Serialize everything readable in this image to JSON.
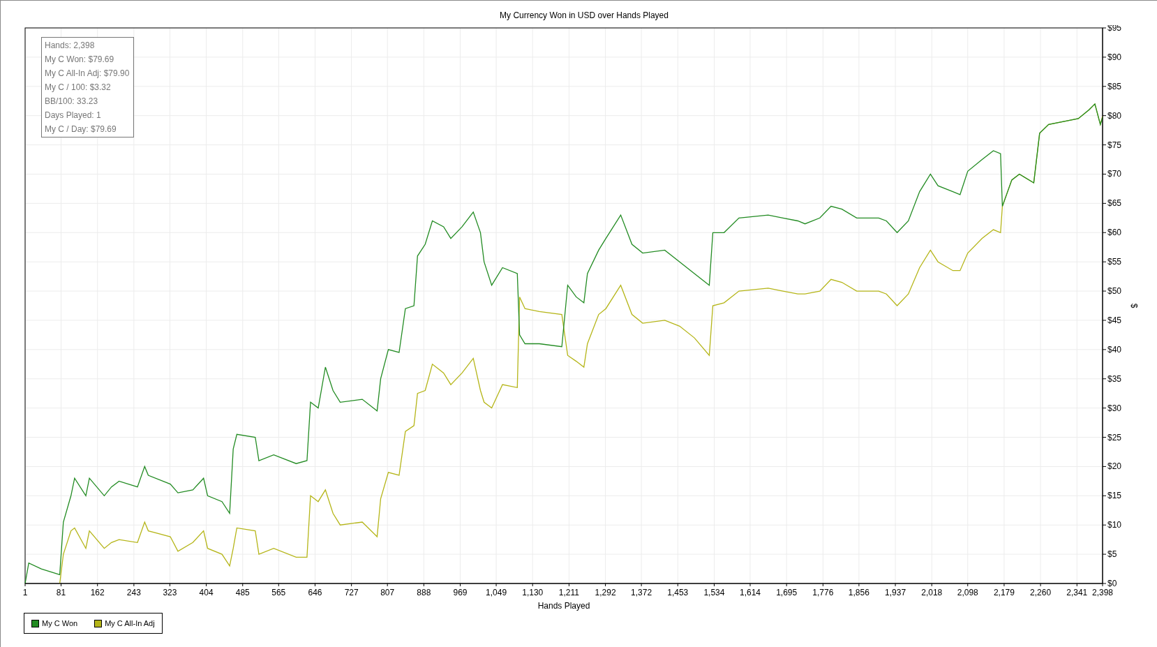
{
  "chart": {
    "chart_data": {
      "type": "line",
      "grid": true,
      "title": "My Currency Won in USD over Hands Played",
      "xlabel": "Hands Played",
      "ylabel": "$",
      "x": [
        1,
        9,
        37,
        78,
        86,
        103,
        111,
        136,
        144,
        177,
        193,
        210,
        251,
        267,
        275,
        324,
        341,
        374,
        398,
        407,
        439,
        456,
        464,
        472,
        513,
        521,
        554,
        604,
        628,
        636,
        653,
        669,
        686,
        702,
        751,
        784,
        792,
        809,
        833,
        847,
        866,
        874,
        891,
        907,
        932,
        948,
        973,
        998,
        1014,
        1022,
        1039,
        1063,
        1096,
        1101,
        1113,
        1145,
        1195,
        1208,
        1227,
        1244,
        1252,
        1277,
        1293,
        1326,
        1351,
        1375,
        1424,
        1457,
        1490,
        1523,
        1531,
        1556,
        1589,
        1654,
        1687,
        1720,
        1736,
        1769,
        1794,
        1818,
        1851,
        1900,
        1917,
        1941,
        1966,
        1991,
        2015,
        2032,
        2065,
        2081,
        2098,
        2130,
        2155,
        2171,
        2175,
        2196,
        2213,
        2245,
        2258,
        2278,
        2311,
        2344,
        2368,
        2381,
        2393,
        2398
      ],
      "series": [
        {
          "name": "My C Won",
          "color": "#228b22",
          "values": [
            0,
            3.5,
            2.5,
            1.5,
            10.5,
            15,
            18,
            15,
            18,
            15,
            16.5,
            17.5,
            16.5,
            20,
            18.5,
            17,
            15.5,
            16,
            18,
            15,
            14,
            12,
            23,
            25.5,
            25,
            21,
            22,
            20.5,
            21,
            31,
            30,
            37,
            33,
            31,
            31.5,
            29.5,
            35,
            40,
            39.5,
            47,
            47.5,
            56,
            58,
            62,
            61,
            59,
            61,
            63.5,
            60,
            55,
            51,
            54,
            53,
            42.5,
            41,
            41,
            40.5,
            51,
            49,
            48,
            53,
            57,
            59,
            63,
            58,
            56.5,
            57,
            55,
            53,
            51,
            60,
            60,
            62.5,
            63,
            62.5,
            62,
            61.5,
            62.5,
            64.5,
            64,
            62.5,
            62.5,
            62,
            60,
            62,
            67,
            70,
            68,
            67,
            66.5,
            70.5,
            72.5,
            74,
            73.5,
            64.5,
            69,
            70,
            68.5,
            77,
            78.5,
            79,
            79.5,
            81,
            82,
            78.5,
            79.7
          ]
        },
        {
          "name": "My C All-In Adj",
          "color": "#b5b518",
          "values": [
            null,
            null,
            null,
            0,
            5,
            9,
            9.5,
            6,
            9,
            6,
            7,
            7.5,
            7,
            10.5,
            9,
            8,
            5.5,
            7,
            9,
            6,
            5,
            3,
            6,
            9.5,
            9,
            5,
            6,
            4.5,
            4.5,
            15,
            14,
            16,
            12,
            10,
            10.5,
            8,
            14.5,
            19,
            18.5,
            26,
            27,
            32.5,
            33,
            37.5,
            36,
            34,
            36,
            38.5,
            33,
            31,
            30,
            34,
            33.5,
            49,
            47,
            46.5,
            46,
            39,
            38,
            37,
            41,
            46,
            47,
            51,
            46,
            44.5,
            45,
            44,
            42,
            39,
            47.5,
            48,
            50,
            50.5,
            50,
            49.5,
            49.5,
            50,
            52,
            51.5,
            50,
            50,
            49.5,
            47.5,
            49.5,
            54,
            57,
            55,
            53.5,
            53.5,
            56.5,
            59,
            60.5,
            60,
            64.5,
            69,
            70,
            68.5,
            77,
            78.5,
            79,
            79.5,
            81,
            82,
            78.5,
            79.9
          ]
        }
      ],
      "xlim": [
        1,
        2398
      ],
      "ylim": [
        0,
        95
      ],
      "xticks": [
        1,
        81,
        162,
        243,
        323,
        404,
        485,
        565,
        646,
        727,
        807,
        888,
        969,
        {
          "value": 1049,
          "label": "1,049"
        },
        {
          "value": 1130,
          "label": "1,130"
        },
        {
          "value": 1211,
          "label": "1,211"
        },
        {
          "value": 1292,
          "label": "1,292"
        },
        {
          "value": 1372,
          "label": "1,372"
        },
        {
          "value": 1453,
          "label": "1,453"
        },
        {
          "value": 1534,
          "label": "1,534"
        },
        {
          "value": 1614,
          "label": "1,614"
        },
        {
          "value": 1695,
          "label": "1,695"
        },
        {
          "value": 1776,
          "label": "1,776"
        },
        {
          "value": 1856,
          "label": "1,856"
        },
        {
          "value": 1937,
          "label": "1,937"
        },
        {
          "value": 2018,
          "label": "2,018"
        },
        {
          "value": 2098,
          "label": "2,098"
        },
        {
          "value": 2179,
          "label": "2,179"
        },
        {
          "value": 2260,
          "label": "2,260"
        },
        {
          "value": 2341,
          "label": "2,341"
        },
        {
          "value": 2398,
          "label": "2,398"
        }
      ],
      "yticks": [
        {
          "value": 0,
          "label": "$0"
        },
        {
          "value": 5,
          "label": "$5"
        },
        {
          "value": 10,
          "label": "$10"
        },
        {
          "value": 15,
          "label": "$15"
        },
        {
          "value": 20,
          "label": "$20"
        },
        {
          "value": 25,
          "label": "$25"
        },
        {
          "value": 30,
          "label": "$30"
        },
        {
          "value": 35,
          "label": "$35"
        },
        {
          "value": 40,
          "label": "$40"
        },
        {
          "value": 45,
          "label": "$45"
        },
        {
          "value": 50,
          "label": "$50"
        },
        {
          "value": 55,
          "label": "$55"
        },
        {
          "value": 60,
          "label": "$60"
        },
        {
          "value": 65,
          "label": "$65"
        },
        {
          "value": 70,
          "label": "$70"
        },
        {
          "value": 75,
          "label": "$75"
        },
        {
          "value": 80,
          "label": "$80"
        },
        {
          "value": 85,
          "label": "$85"
        },
        {
          "value": 90,
          "label": "$90"
        },
        {
          "value": 95,
          "label": "$95"
        }
      ]
    }
  },
  "stats": [
    "Hands: 2,398",
    "My C Won: $79.69",
    "My C All-In Adj: $79.90",
    "My C / 100: $3.32",
    "BB/100: 33.23",
    "Days Played: 1",
    "My C / Day: $79.69"
  ]
}
